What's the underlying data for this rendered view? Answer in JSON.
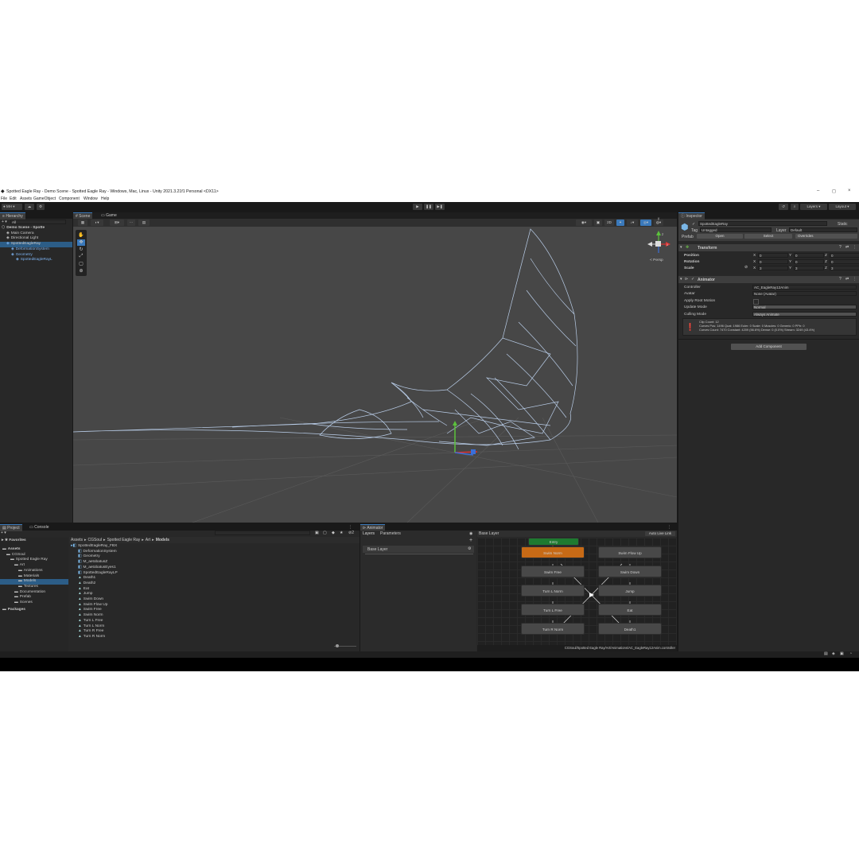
{
  "window": {
    "title": "Spotted Eagle Ray - Demo Scene - Spotted Eagle Ray - Windows, Mac, Linux - Unity 2021.3.21f1 Personal <DX11>",
    "controls": [
      "–",
      "◻",
      "×"
    ]
  },
  "menu": [
    "File",
    "Edit",
    "Assets",
    "GameObject",
    "Component",
    "Window",
    "Help"
  ],
  "toolbar": {
    "account": "MH",
    "play": "▶",
    "pause": "❚❚",
    "step": "▶❚",
    "layers": "Layers",
    "layout": "Layout"
  },
  "hierarchy": {
    "tab": "Hierarchy",
    "search_placeholder": "All",
    "items": [
      {
        "label": "Demo Scene - Spotte",
        "indent": 0
      },
      {
        "label": "Main Camera",
        "indent": 1
      },
      {
        "label": "Directional Light",
        "indent": 1
      },
      {
        "label": "SpottedEagleRay",
        "indent": 1
      },
      {
        "label": "DeformationSystem",
        "indent": 2
      },
      {
        "label": "Geometry",
        "indent": 2
      },
      {
        "label": "SpottedEagleRayL",
        "indent": 3
      }
    ]
  },
  "scene": {
    "tabs": [
      "Scene",
      "Game"
    ],
    "persp": "< Persp",
    "gizmo_axes": {
      "y": "y",
      "x": "x",
      "z": "z"
    }
  },
  "inspector": {
    "tab": "Inspector",
    "object_name": "SpottedEagleRay",
    "static": "Static",
    "tag_label": "Tag",
    "tag_value": "Untagged",
    "layer_label": "Layer",
    "layer_value": "Default",
    "prefab_label": "Prefab",
    "open": "Open",
    "select": "Select",
    "overrides": "Overrides",
    "transform": {
      "title": "Transform",
      "rows": [
        {
          "label": "Position",
          "x": "0",
          "y": "0",
          "z": "0"
        },
        {
          "label": "Rotation",
          "x": "0",
          "y": "0",
          "z": "0"
        },
        {
          "label": "Scale",
          "x": "3",
          "y": "3",
          "z": "3"
        }
      ]
    },
    "animator": {
      "title": "Animator",
      "fields": [
        {
          "label": "Controller",
          "value": "AC_EagleRay12Anim"
        },
        {
          "label": "Avatar",
          "value": "None (Avatar)"
        },
        {
          "label": "Apply Root Motion",
          "value": ""
        },
        {
          "label": "Update Mode",
          "value": "Normal"
        },
        {
          "label": "Culling Mode",
          "value": "Always Animate"
        }
      ],
      "info_lines": [
        "Clip Count: 12",
        "Curves Pos: 1496 Quat: 1986 Euler: 0 Scale: 0 Muscles: 0 Generic: 0 PPtr: 0",
        "Curves Count: 7470 Constant: 4209 (56.6%) Dense: 0 (0.0%) Stream: 3249 (43.4%)"
      ]
    },
    "add_component": "Add Component"
  },
  "project": {
    "tabs": [
      "Project",
      "Console"
    ],
    "favorites": "Favorites",
    "tree": [
      {
        "label": "Assets",
        "indent": 0,
        "bold": true
      },
      {
        "label": "CGSoul",
        "indent": 1
      },
      {
        "label": "Spotted Eagle Ray",
        "indent": 2
      },
      {
        "label": "Art",
        "indent": 3
      },
      {
        "label": "Animations",
        "indent": 4
      },
      {
        "label": "Materials",
        "indent": 4
      },
      {
        "label": "Models",
        "indent": 4,
        "selected": true
      },
      {
        "label": "Textures",
        "indent": 4
      },
      {
        "label": "Documentation",
        "indent": 3
      },
      {
        "label": "Prefab",
        "indent": 3
      },
      {
        "label": "Scenes",
        "indent": 3
      },
      {
        "label": "Packages",
        "indent": 0,
        "bold": true
      }
    ],
    "breadcrumb": [
      "Assets",
      "CGSoul",
      "Spotted Eagle Ray",
      "Art",
      "Models"
    ],
    "files": [
      {
        "label": "SpottedEagleRay_FBX",
        "indent": 0
      },
      {
        "label": "DeformationSystem",
        "indent": 1
      },
      {
        "label": "Geometry",
        "indent": 1
      },
      {
        "label": "M_aetobatusZ",
        "indent": 1
      },
      {
        "label": "M_aetobatusEyes1",
        "indent": 1
      },
      {
        "label": "SpottedEagleRayLP",
        "indent": 1
      },
      {
        "label": "Death1",
        "indent": 1
      },
      {
        "label": "Death2",
        "indent": 1
      },
      {
        "label": "Eat",
        "indent": 1
      },
      {
        "label": "Jump",
        "indent": 1
      },
      {
        "label": "Swim Down",
        "indent": 1
      },
      {
        "label": "Swim Flow Up",
        "indent": 1
      },
      {
        "label": "Swim Free",
        "indent": 1
      },
      {
        "label": "Swim Norm",
        "indent": 1
      },
      {
        "label": "Turn L Free",
        "indent": 1
      },
      {
        "label": "Turn L Norm",
        "indent": 1
      },
      {
        "label": "Turn R Free",
        "indent": 1
      },
      {
        "label": "Turn R Norm",
        "indent": 1
      }
    ],
    "item_count": "2"
  },
  "animator_window": {
    "tab": "Animator",
    "layers_tab": "Layers",
    "parameters_tab": "Parameters",
    "breadcrumb": "Base Layer",
    "auto_live_link": "Auto Live Link",
    "base_layer": "Base Layer",
    "entry": "Entry",
    "states_left": [
      "Swim Norm",
      "Swim Free",
      "Turn L Norm",
      "Turn L Free",
      "Turn R Norm"
    ],
    "states_right": [
      "Swim Flow Up",
      "Swim Down",
      "Jump",
      "Eat",
      "Death1"
    ],
    "footer_path": "CGSoul/Spotted Eagle Ray/Art/Animations/AC_EagleRay12Anim.controller"
  },
  "colors": {
    "editor_bg": "#191919",
    "panel_bg": "#282828",
    "scene_bg": "#474747",
    "selection": "#2c5d87",
    "orange_state": "#c76a16",
    "entry_state": "#1e7a30",
    "wireframe": "#b9cde8"
  }
}
